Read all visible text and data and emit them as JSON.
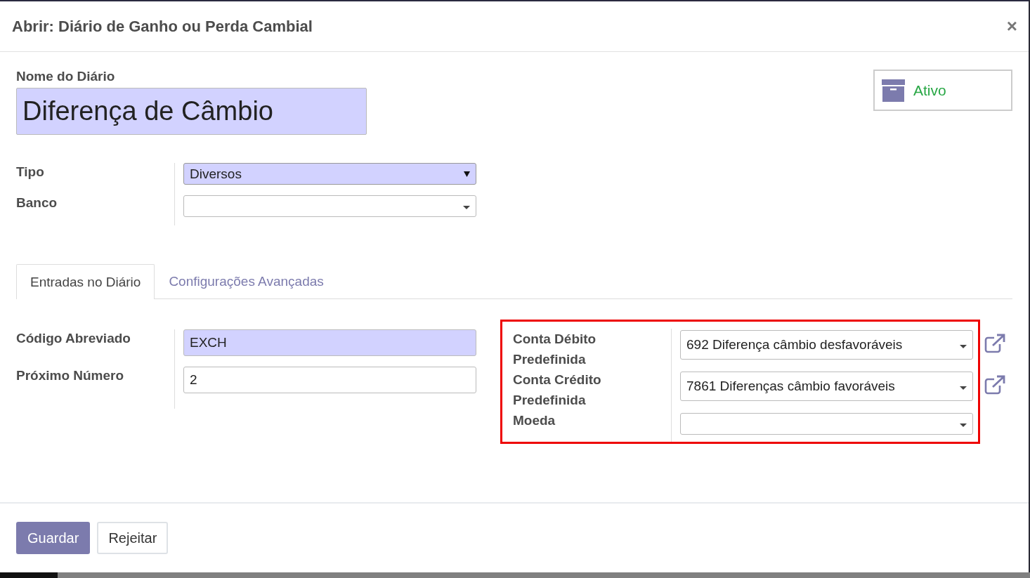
{
  "dialog": {
    "title": "Abrir: Diário de Ganho ou Perda Cambial",
    "close": "×"
  },
  "name_field": {
    "label": "Nome do Diário",
    "value": "Diferença de Câmbio",
    "required": true
  },
  "status_button": {
    "label": "Ativo",
    "active": true
  },
  "header_fields": [
    {
      "label": "Tipo",
      "value": "Diversos",
      "required": true,
      "kind": "select"
    },
    {
      "label": "Banco",
      "required": false,
      "kind": "many2one"
    }
  ],
  "tabs": [
    {
      "label": "Entradas no Diário",
      "selected": true
    },
    {
      "label": "Configurações Avançadas",
      "selected": false
    }
  ],
  "left_fields": [
    {
      "label": "Código Abreviado",
      "value": "EXCH",
      "required": true
    },
    {
      "label": "Próximo Número",
      "value": "2",
      "required": false
    }
  ],
  "right_group": {
    "highlighted": true,
    "fields": [
      {
        "label": "Conta Débito Predefinida",
        "value": "692 Diferença câmbio desfavoráveis",
        "required": false,
        "kind": "many2one",
        "external_link": true
      },
      {
        "label": "Conta Crédito Predefinida",
        "value": "7861 Diferenças câmbio favoráveis",
        "required": false,
        "kind": "many2one",
        "external_link": true
      },
      {
        "label": "Moeda",
        "required": false,
        "kind": "many2one",
        "external_link": false
      }
    ]
  },
  "buttons": [
    {
      "label": "Guardar",
      "kind": "primary"
    },
    {
      "label": "Rejeitar",
      "kind": "secondary"
    }
  ]
}
